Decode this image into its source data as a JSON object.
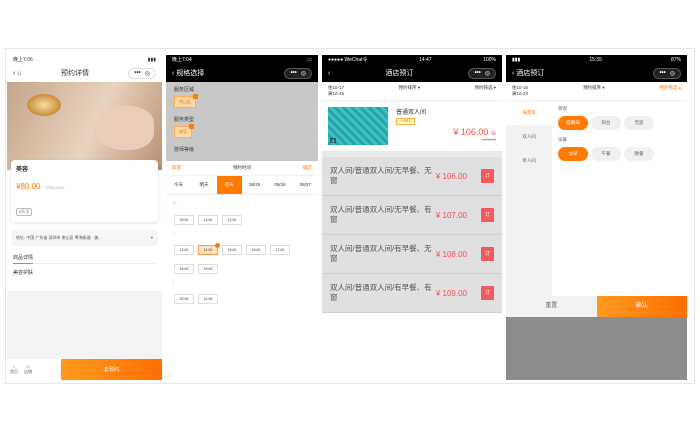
{
  "screen1": {
    "status_left": "晚上7:06",
    "nav_title": "预约详情",
    "title": "美容",
    "price": "¥80.00",
    "price_note": "门市价:¥100",
    "tag": "8折扣",
    "address_label": "地址:",
    "address": "中国 广东省 深圳市 南山区 粤海街道 · 美...",
    "tab": "商品详情",
    "section": "美容护肤",
    "home_label": "首页",
    "shop_label": "店铺",
    "book_button": "去预约"
  },
  "screen2": {
    "status_left": "晚上7:04",
    "nav_title": "规格选择",
    "area_title": "服务区域",
    "area_chip": "南山区",
    "type_title": "服务类型",
    "type_chip": "美容",
    "grade_title": "技师等级",
    "cancel": "取消",
    "sheet_title": "预约时间",
    "confirm": "确定",
    "dates": [
      "今天",
      "明天",
      "后天",
      "08/25",
      "08/26",
      "08/27"
    ],
    "slots_morning": [
      "09:00",
      "11:00",
      "12:00"
    ],
    "slots_afternoon": [
      "13:00",
      "14:00",
      "15:00",
      "16:00",
      "17:00",
      "18:00",
      "19:00"
    ],
    "slots_evening": [
      "20:00",
      "21:00"
    ]
  },
  "screen3": {
    "status_left": "●●●●● WeChat令",
    "time": "14:47",
    "battery": "100%",
    "nav_title": "酒店预订",
    "checkin": "住10-17",
    "checkout": "离10-25",
    "sort": "预约排序",
    "filter": "预约筛选",
    "room_name": "普通双人间",
    "room_badge": "24h确认",
    "room_price": "¥ 106.00",
    "room_orig": "¥228.00",
    "photo_count": "1",
    "book_label": "订",
    "book_sub": "预付",
    "options": [
      {
        "name": "双人间/普通双人间/无早餐、无窗",
        "price": "¥ 106.00"
      },
      {
        "name": "双人间/普通双人间/无早餐、有窗",
        "price": "¥ 107.00"
      },
      {
        "name": "双人间/普通双人间/有早餐、无窗",
        "price": "¥ 108.00"
      },
      {
        "name": "双人间/普通双人间/有早餐、有窗",
        "price": "¥ 109.00"
      }
    ]
  },
  "screen4": {
    "time": "15:35",
    "battery": "87%",
    "nav_title": "酒店预订",
    "checkin": "住10-16",
    "checkout": "离10-23",
    "sort": "预约排序",
    "filter": "预约筛选",
    "side": [
      "海景房",
      "双人间",
      "单人间"
    ],
    "g1_title": "景观",
    "g1": [
      "面朝海",
      "阳台",
      "无窗"
    ],
    "g2_title": "早餐",
    "g2": [
      "含早",
      "午餐",
      "晚餐"
    ],
    "reset": "重置",
    "ok": "确认"
  },
  "colors": {
    "accent": "#ff7a00",
    "price_red": "#ff4a4a"
  }
}
